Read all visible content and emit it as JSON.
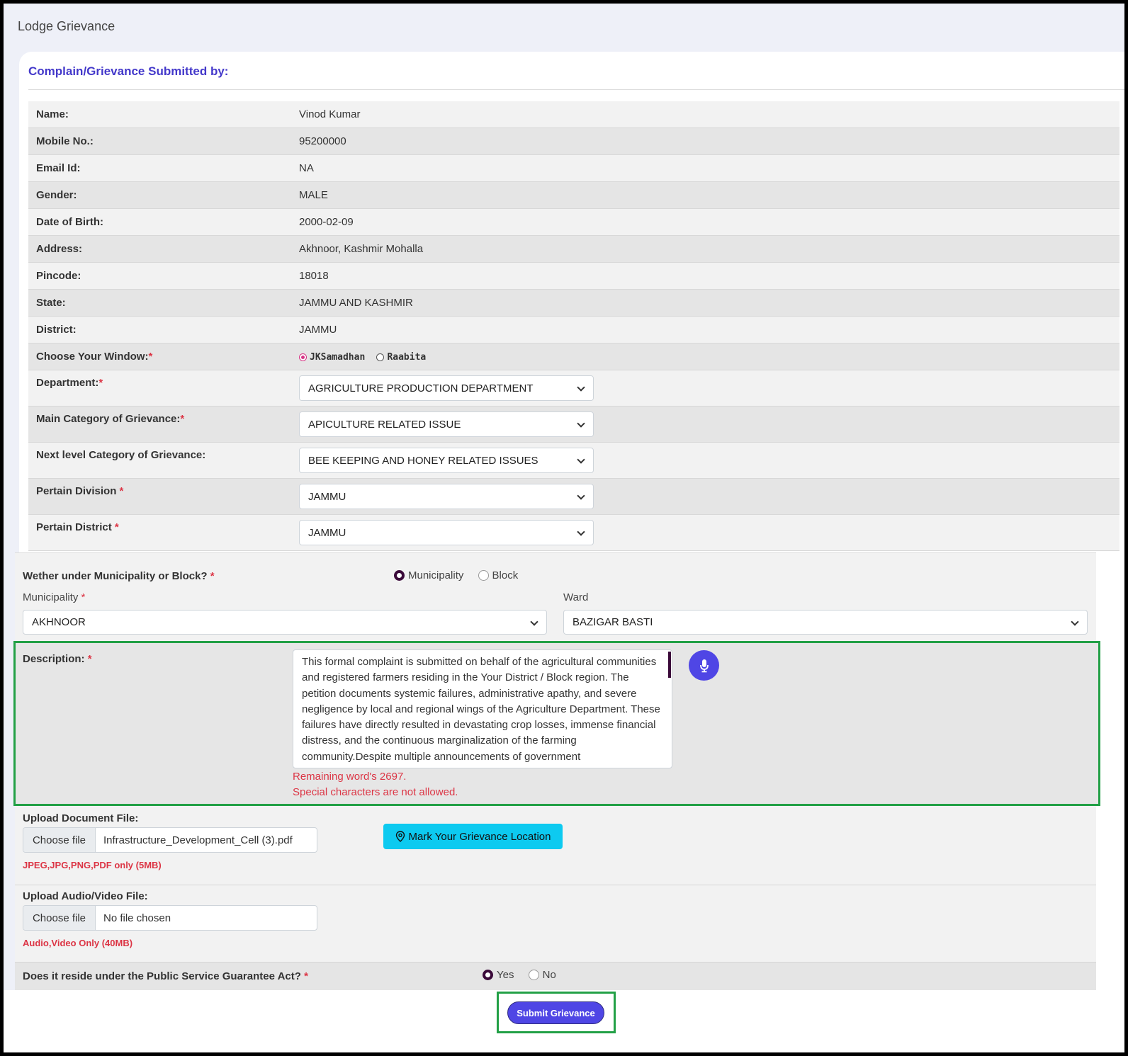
{
  "page": {
    "heading": "Lodge Grievance"
  },
  "card": {
    "title": "Complain/Grievance Submitted by:"
  },
  "info": {
    "name_label": "Name:",
    "name": "Vinod Kumar",
    "mobile_label": "Mobile No.:",
    "mobile": "95200000",
    "email_label": "Email Id:",
    "email": "NA",
    "gender_label": "Gender:",
    "gender": "MALE",
    "dob_label": "Date of Birth:",
    "dob": "2000-02-09",
    "address_label": "Address:",
    "address": "Akhnoor, Kashmir Mohalla",
    "pincode_label": "Pincode:",
    "pincode": "18018",
    "state_label": "State:",
    "state": "JAMMU AND KASHMIR",
    "district_label": "District:",
    "district": "JAMMU"
  },
  "window": {
    "label": "Choose Your Window:",
    "options": [
      "JKSamadhan",
      "Raabita"
    ],
    "selected": "JKSamadhan"
  },
  "department": {
    "label": "Department:",
    "value": "AGRICULTURE PRODUCTION DEPARTMENT"
  },
  "main_category": {
    "label": "Main Category of Grievance:",
    "value": "APICULTURE RELATED ISSUE"
  },
  "next_category": {
    "label": "Next level Category of Grievance:",
    "value": "BEE KEEPING AND HONEY RELATED ISSUES"
  },
  "pertain_division": {
    "label": "Pertain Division",
    "value": "JAMMU"
  },
  "pertain_district": {
    "label": "Pertain District",
    "value": "JAMMU"
  },
  "municipality_block": {
    "question": "Wether under Municipality or Block?",
    "options": [
      "Municipality",
      "Block"
    ],
    "selected": "Municipality"
  },
  "municipality": {
    "label": "Municipality",
    "value": "AKHNOOR"
  },
  "ward": {
    "label": "Ward",
    "value": "BAZIGAR BASTI"
  },
  "description": {
    "label": "Description:",
    "value": "This formal complaint is submitted on behalf of the agricultural communities and registered farmers residing in the Your District / Block region. The petition documents systemic failures, administrative apathy, and severe negligence by local and regional wings of the Agriculture Department. These failures have directly resulted in devastating crop losses, immense financial distress, and the continuous marginalization of the farming community.Despite multiple announcements of government",
    "remaining": "Remaining word's 2697.",
    "special_chars": "Special characters are not allowed."
  },
  "upload_doc": {
    "label": "Upload Document File:",
    "button": "Choose file",
    "file": "Infrastructure_Development_Cell (3).pdf",
    "hint": "JPEG,JPG,PNG,PDF only (5MB)"
  },
  "location_button": "Mark Your Grievance Location",
  "upload_av": {
    "label": "Upload Audio/Video File:",
    "button": "Choose file",
    "file": "No file chosen",
    "hint": "Audio,Video Only (40MB)"
  },
  "psga": {
    "question": "Does it reside under the Public Service Guarantee Act?",
    "options": [
      "Yes",
      "No"
    ],
    "selected": "Yes"
  },
  "submit_label": "Submit Grievance",
  "colors": {
    "accent": "#4f46e5",
    "title": "#4338ca",
    "error": "#dc3545",
    "highlight": "#22a046",
    "info_button": "#0dcaf0"
  }
}
